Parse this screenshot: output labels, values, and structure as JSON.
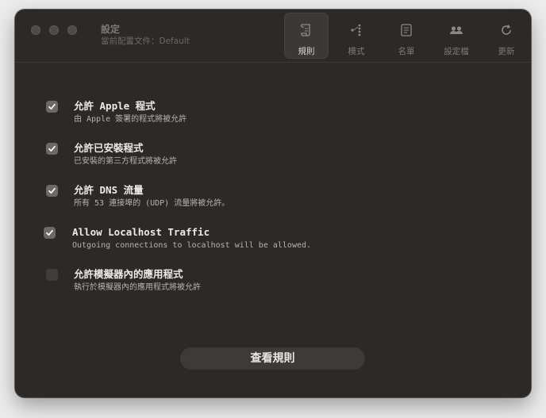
{
  "window": {
    "title": "設定",
    "subtitle": "當前配置文件：Default"
  },
  "tabs": [
    {
      "label": "規則",
      "icon": "scroll-icon",
      "active": true
    },
    {
      "label": "模式",
      "icon": "network-nodes-icon",
      "active": false
    },
    {
      "label": "名單",
      "icon": "list-document-icon",
      "active": false
    },
    {
      "label": "設定檔",
      "icon": "profiles-icon",
      "active": false
    },
    {
      "label": "更新",
      "icon": "refresh-icon",
      "active": false
    }
  ],
  "options": [
    {
      "title": "允許 Apple 程式",
      "description": "由 Apple 簽署的程式將被允許",
      "checked": true
    },
    {
      "title": "允許已安裝程式",
      "description": "已安裝的第三方程式將被允許",
      "checked": true
    },
    {
      "title": "允許 DNS 流量",
      "description": "所有 53 連接埠的  (UDP) 流量將被允許。",
      "checked": true
    },
    {
      "title": "Allow Localhost Traffic",
      "description": "Outgoing connections to localhost will be allowed.",
      "checked": true
    },
    {
      "title": "允許模擬器內的應用程式",
      "description": "執行於模擬器內的應用程式將被允許",
      "checked": false
    }
  ],
  "actions": {
    "view_rules_label": "查看規則"
  }
}
